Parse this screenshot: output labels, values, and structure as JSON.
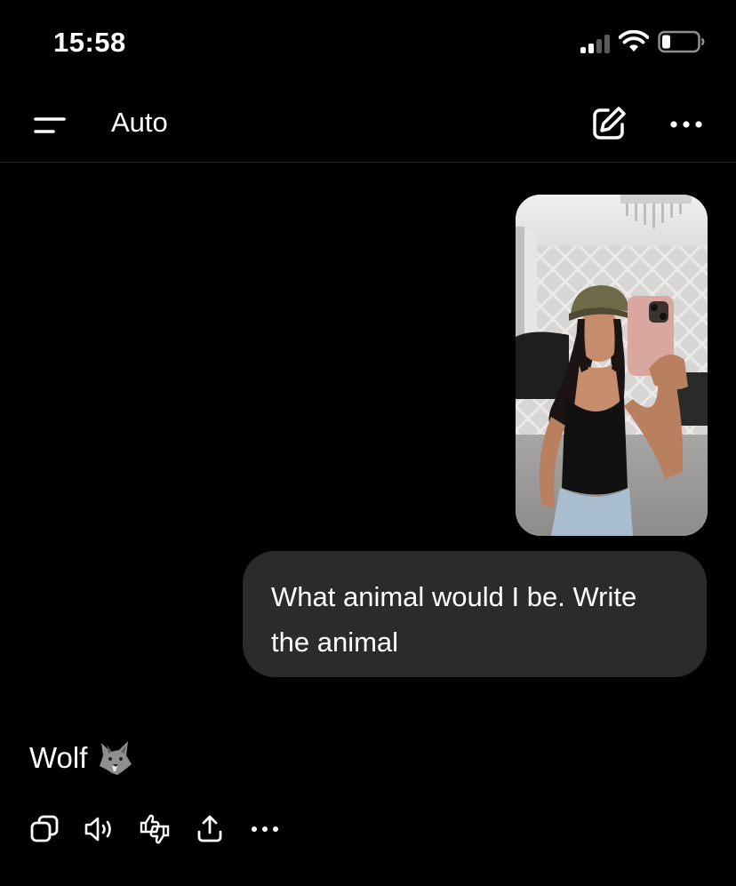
{
  "status_bar": {
    "time": "15:58"
  },
  "header": {
    "title": "Auto",
    "menu_icon": "menu-icon",
    "compose_icon": "compose-icon",
    "more_icon": "more-horizontal-icon"
  },
  "conversation": {
    "user_image": {
      "icon": "photo-attachment"
    },
    "user_message": "What animal would I be. Write the animal",
    "assistant_message": "Wolf",
    "assistant_emoji_icon": "wolf-icon"
  },
  "actions": [
    {
      "name": "copy",
      "icon": "copy-icon"
    },
    {
      "name": "read-aloud",
      "icon": "speaker-icon"
    },
    {
      "name": "rate",
      "icon": "thumbs-icon"
    },
    {
      "name": "share",
      "icon": "share-icon"
    },
    {
      "name": "more",
      "icon": "more-horizontal-icon"
    }
  ],
  "colors": {
    "background": "#000000",
    "bubble": "#2b2b2b",
    "text": "#ffffff",
    "divider": "#2a2a2a"
  }
}
